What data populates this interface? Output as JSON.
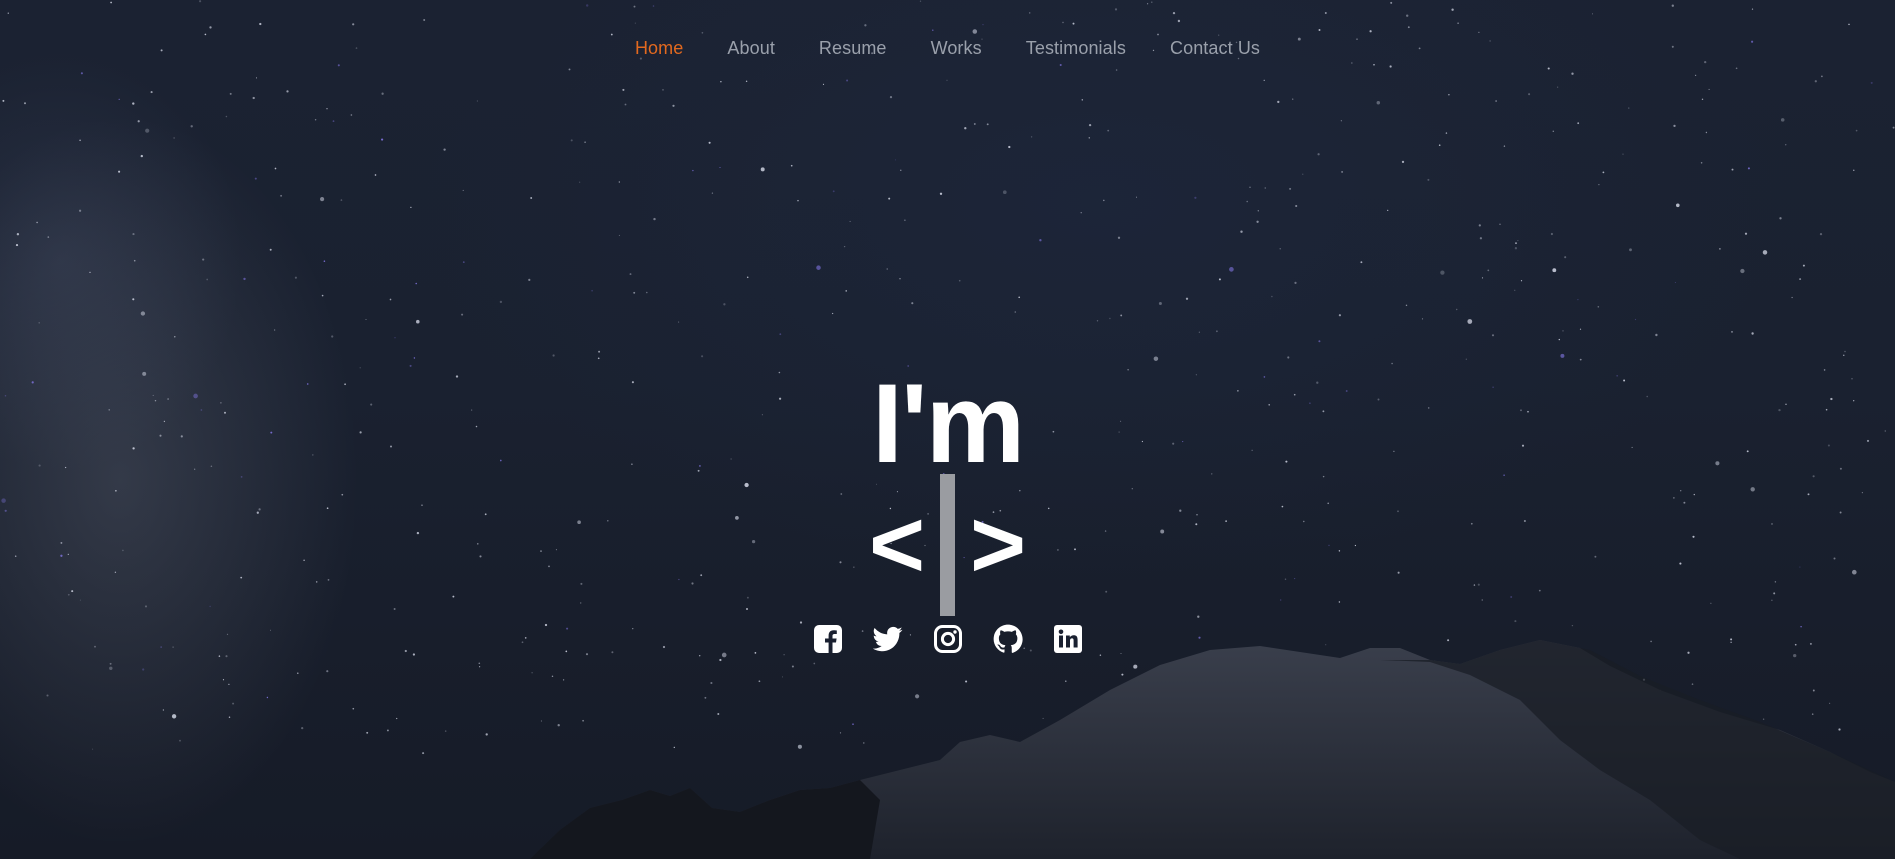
{
  "nav": {
    "items": [
      {
        "label": "Home",
        "active": true
      },
      {
        "label": "About",
        "active": false
      },
      {
        "label": "Resume",
        "active": false
      },
      {
        "label": "Works",
        "active": false
      },
      {
        "label": "Testimonials",
        "active": false
      },
      {
        "label": "Contact Us",
        "active": false
      }
    ],
    "active_color": "#e2691f",
    "inactive_color": "#9aa0ab"
  },
  "hero": {
    "title": "I'm",
    "typed_open": "<",
    "typed_close": ">"
  },
  "social": {
    "icons": [
      "facebook-icon",
      "twitter-icon",
      "instagram-icon",
      "github-icon",
      "linkedin-icon"
    ]
  }
}
